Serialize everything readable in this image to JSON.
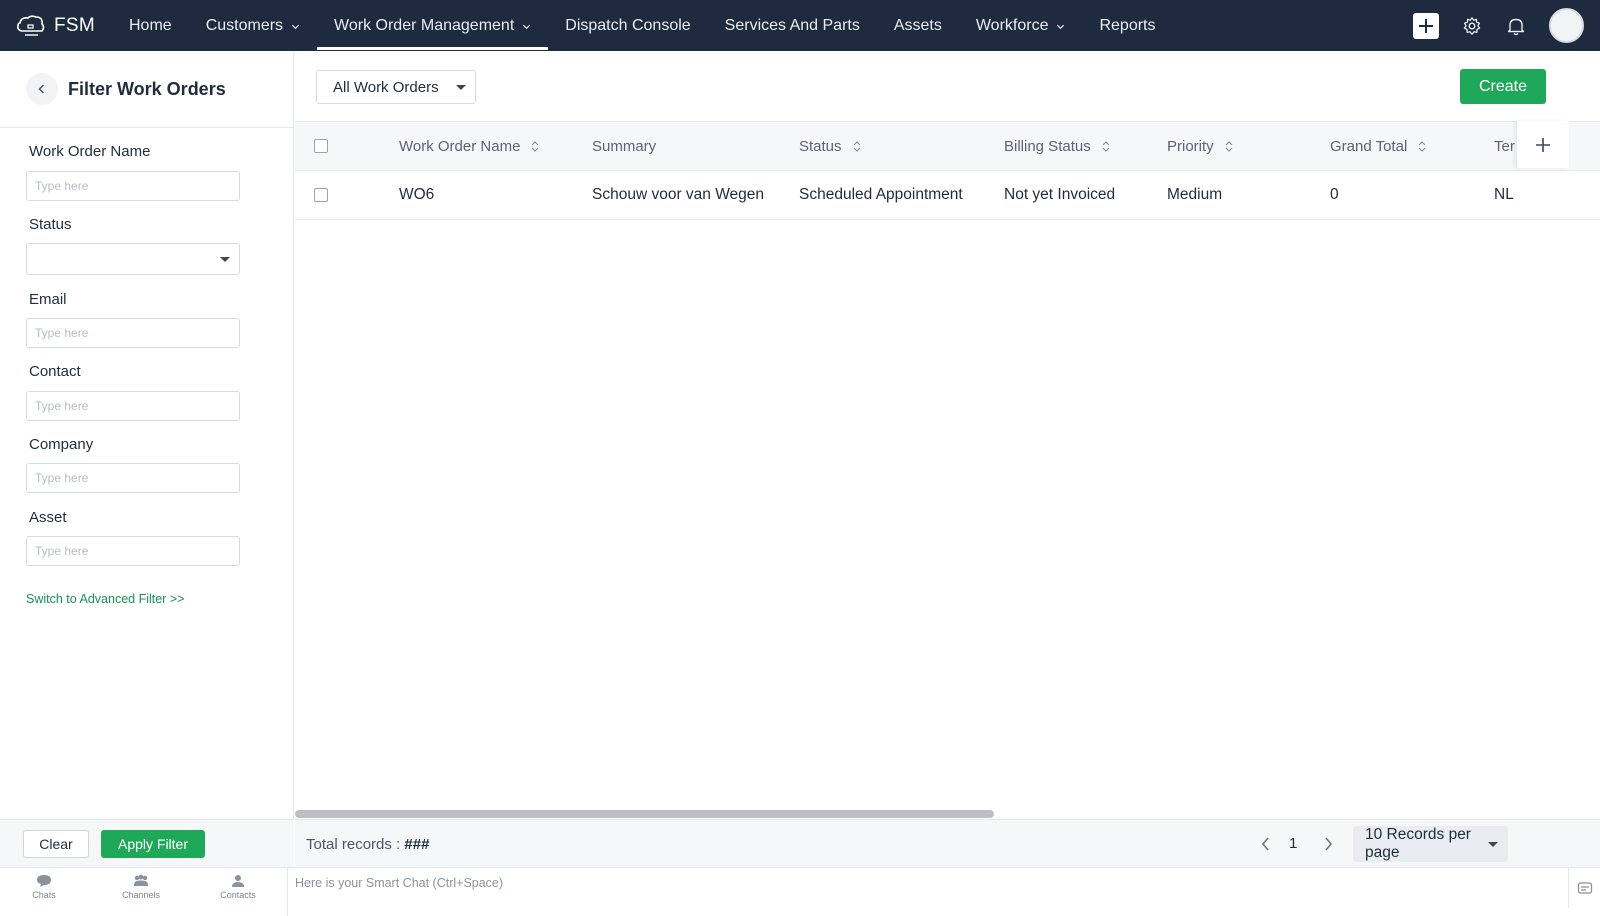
{
  "app": {
    "brand": "FSM"
  },
  "nav": {
    "items": [
      {
        "label": "Home",
        "has_dropdown": false,
        "active": false
      },
      {
        "label": "Customers",
        "has_dropdown": true,
        "active": false
      },
      {
        "label": "Work Order Management",
        "has_dropdown": true,
        "active": true
      },
      {
        "label": "Dispatch Console",
        "has_dropdown": false,
        "active": false
      },
      {
        "label": "Services And Parts",
        "has_dropdown": false,
        "active": false
      },
      {
        "label": "Assets",
        "has_dropdown": false,
        "active": false
      },
      {
        "label": "Workforce",
        "has_dropdown": true,
        "active": false
      },
      {
        "label": "Reports",
        "has_dropdown": false,
        "active": false
      }
    ],
    "right_icons": [
      "plus-icon",
      "gear-icon",
      "bell-icon",
      "avatar"
    ]
  },
  "filter": {
    "title": "Filter Work Orders",
    "fields": {
      "work_order_name": {
        "label": "Work Order Name",
        "placeholder": "Type here",
        "value": ""
      },
      "status": {
        "label": "Status",
        "value": ""
      },
      "email": {
        "label": "Email",
        "placeholder": "Type here",
        "value": ""
      },
      "contact": {
        "label": "Contact",
        "placeholder": "Type here",
        "value": ""
      },
      "company": {
        "label": "Company",
        "placeholder": "Type here",
        "value": ""
      },
      "asset": {
        "label": "Asset",
        "placeholder": "Type here",
        "value": ""
      }
    },
    "advanced_link": "Switch to Advanced Filter >>",
    "clear_label": "Clear",
    "apply_label": "Apply Filter"
  },
  "main": {
    "view_selector": "All Work Orders",
    "create_label": "Create",
    "columns": [
      "Work Order Name",
      "Summary",
      "Status",
      "Billing Status",
      "Priority",
      "Grand Total",
      "Ter"
    ],
    "sortable_columns": [
      "Work Order Name",
      "Status",
      "Billing Status",
      "Priority",
      "Grand Total"
    ],
    "rows": [
      {
        "work_order_name": "WO6",
        "summary": "Schouw voor van Wegen",
        "status": "Scheduled Appointment",
        "billing_status": "Not yet Invoiced",
        "priority": "Medium",
        "grand_total": "0",
        "territory": "NL"
      }
    ],
    "footer": {
      "total_label": "Total records :",
      "total_value": "###",
      "page": "1",
      "per_page": "10 Records per page"
    }
  },
  "chatbar": {
    "tabs": [
      {
        "label": "Chats",
        "icon": "chat-icon"
      },
      {
        "label": "Channels",
        "icon": "channels-icon"
      },
      {
        "label": "Contacts",
        "icon": "contacts-icon"
      }
    ],
    "placeholder": "Here is your Smart Chat (Ctrl+Space)"
  },
  "colors": {
    "nav_bg": "#1e2a3e",
    "accent_green": "#20a85a",
    "link_green": "#1a8f55"
  }
}
